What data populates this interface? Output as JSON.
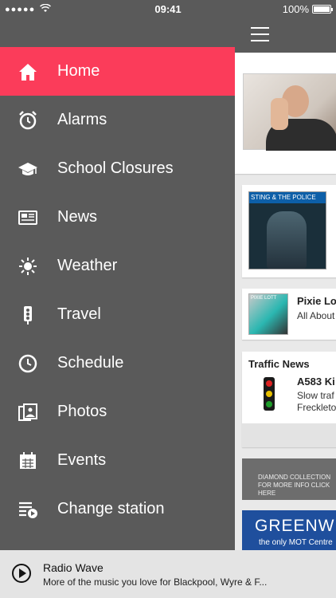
{
  "status_bar": {
    "signal": "●●●●●",
    "time": "09:41",
    "battery": "100%"
  },
  "menu": {
    "items": [
      {
        "label": "Home",
        "icon": "home-icon",
        "active": true
      },
      {
        "label": "Alarms",
        "icon": "alarm-clock-icon"
      },
      {
        "label": "School Closures",
        "icon": "graduation-cap-icon"
      },
      {
        "label": "News",
        "icon": "newspaper-icon"
      },
      {
        "label": "Weather",
        "icon": "sun-icon"
      },
      {
        "label": "Travel",
        "icon": "traffic-light-icon"
      },
      {
        "label": "Schedule",
        "icon": "clock-icon"
      },
      {
        "label": "Photos",
        "icon": "photos-icon"
      },
      {
        "label": "Events",
        "icon": "calendar-icon"
      },
      {
        "label": "Change station",
        "icon": "playlist-play-icon"
      }
    ]
  },
  "content": {
    "album1_label": "STING & THE POLICE",
    "song2": {
      "title": "Pixie Lo",
      "subtitle": "All About",
      "album_label": "PIXIE LOTT"
    },
    "traffic": {
      "heading": "Traffic News",
      "title": "A583 Ki",
      "line1": "Slow traf",
      "line2": "Freckleto"
    },
    "ad1": {
      "line1": "DIAMOND COLLECTION",
      "line2": "FOR MORE INFO CLICK HERE"
    },
    "ad2": {
      "big": "GREENW",
      "small": "the only MOT Centre"
    }
  },
  "player": {
    "station": "Radio Wave",
    "tagline": "More of the music you love for Blackpool, Wyre & F..."
  },
  "colors": {
    "accent": "#fb3c5a",
    "drawer": "#5a5a5a"
  }
}
